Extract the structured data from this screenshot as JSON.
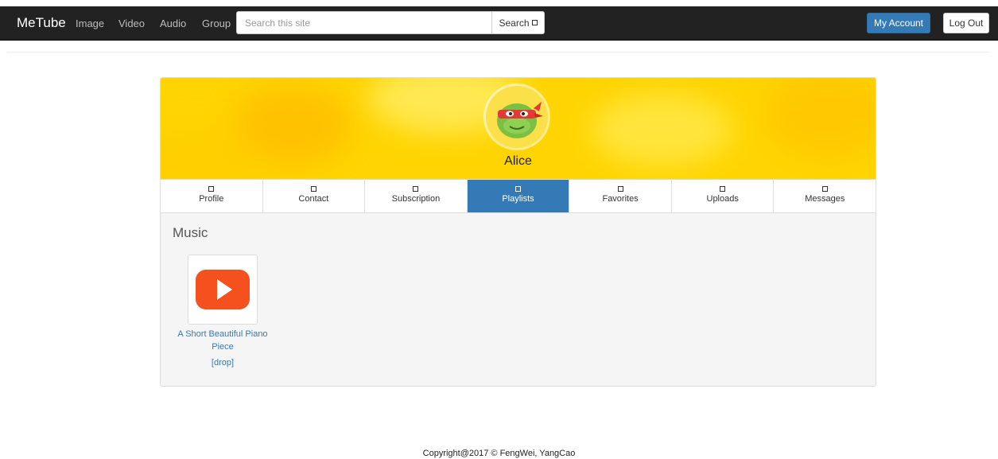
{
  "navbar": {
    "brand": "MeTube",
    "links": [
      "Image",
      "Video",
      "Audio",
      "Group"
    ],
    "search": {
      "placeholder": "Search this site",
      "value": "",
      "button_label": "Search",
      "button_icon": "search-glyph-icon"
    },
    "account_button": "My Account",
    "logout_button": "Log Out"
  },
  "profile": {
    "name": "Alice",
    "avatar": "turtle-avatar-icon",
    "banner_color": "#ffd400"
  },
  "tabs": [
    {
      "label": "Profile",
      "icon": "tab-glyph-icon",
      "active": false
    },
    {
      "label": "Contact",
      "icon": "tab-glyph-icon",
      "active": false
    },
    {
      "label": "Subscription",
      "icon": "tab-glyph-icon",
      "active": false
    },
    {
      "label": "Playlists",
      "icon": "tab-glyph-icon",
      "active": true
    },
    {
      "label": "Favorites",
      "icon": "tab-glyph-icon",
      "active": false
    },
    {
      "label": "Uploads",
      "icon": "tab-glyph-icon",
      "active": false
    },
    {
      "label": "Messages",
      "icon": "tab-glyph-icon",
      "active": false
    }
  ],
  "playlist": {
    "title": "Music",
    "items": [
      {
        "title": "A Short Beautiful Piano Piece",
        "thumbnail": "video-play-icon",
        "action": "[drop]"
      }
    ]
  },
  "footer": {
    "copyright": "Copyright@2017 © FengWei, YangCao"
  },
  "colors": {
    "navbar": "#222222",
    "primary": "#337ab7",
    "play_red": "#f4511e"
  }
}
